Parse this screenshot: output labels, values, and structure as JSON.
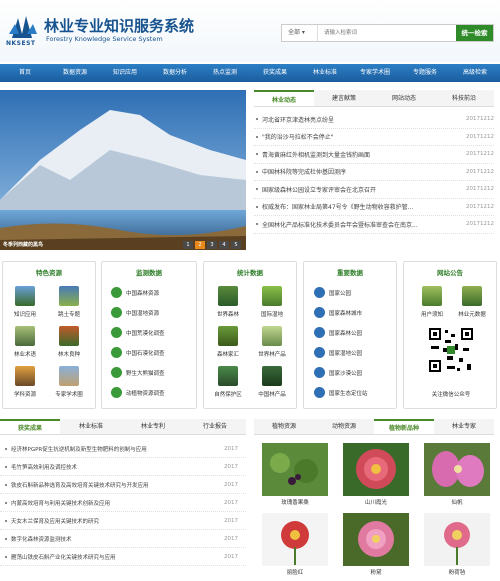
{
  "header": {
    "title_cn": "林业专业知识服务系统",
    "title_en": "Forestry Knowledge Service System",
    "logo_text": "NKSEST"
  },
  "search": {
    "scope": "全部 ▾",
    "placeholder": "请输入检索词",
    "button": "统一检索"
  },
  "nav": [
    "首页",
    "数据资源",
    "知识应用",
    "数据分析",
    "热点监测",
    "获奖成果",
    "林业标准",
    "专家学术圈",
    "专题服务",
    "高级检索"
  ],
  "banner": {
    "caption": "冬季列西藏的黑鸟",
    "pages": [
      "1",
      "2",
      "3",
      "4",
      "5"
    ],
    "active_page": "2"
  },
  "news": {
    "tabs": [
      "林业动态",
      "建言献策",
      "网站动态",
      "科技前沿"
    ],
    "active_tab": "林业动态",
    "items": [
      {
        "title": "河北省环京津造林亮点纷呈",
        "date": "20171212"
      },
      {
        "title": "\"我的治沙马拉松不会停止\"",
        "date": "20171212"
      },
      {
        "title": "青海黄麻红外相机监测到大量金钱豹画面",
        "date": "20171212"
      },
      {
        "title": "中国林科院等完成杜仲基因测序",
        "date": "20171212"
      },
      {
        "title": "国家级森林公园设立专家评审会在北京召开",
        "date": "20171212"
      },
      {
        "title": "权威发布：国家林业局第47号令《野生动物收容救护管...",
        "date": "20171212"
      },
      {
        "title": "全国林化产品标准化技术委员会年会暨标准审查会在南京...",
        "date": "20171212"
      }
    ]
  },
  "features": {
    "title": "特色资源",
    "items": [
      "知识应用",
      "跳土专题",
      "林业术语",
      "林木良种",
      "学科资源",
      "专家学术圈"
    ]
  },
  "monitor": {
    "title": "监测数据",
    "items": [
      "中国森林资源",
      "中国湿地资源",
      "中国荒漠化调查",
      "中国石漠化调查",
      "野生大熊猫调查",
      "动植物资源调查"
    ]
  },
  "stats": {
    "title": "统计数据",
    "items": [
      "世界森林",
      "国际湿地",
      "森林家汇",
      "世界林产品",
      "自然保护区",
      "中国林产品"
    ]
  },
  "important": {
    "title": "重要数据",
    "items": [
      "国家公园",
      "国家森林城市",
      "国家森林公园",
      "国家湿地公园",
      "国家沙漠公园",
      "国家生态定位站"
    ]
  },
  "notice": {
    "title": "网站公告",
    "items": [
      "用户须知",
      "林业元数据"
    ],
    "qr_caption": "关注微信公众号"
  },
  "awards": {
    "tabs": [
      "获奖成果",
      "林业标准",
      "林业专利",
      "行业报告"
    ],
    "active_tab": "获奖成果",
    "items": [
      {
        "title": "经济林PGPR促生抗逆机制及新型生物肥料的创制与应用",
        "date": "2017"
      },
      {
        "title": "毛竹笋高效利用及调控技术",
        "date": "2017"
      },
      {
        "title": "铁皮石斛新品种选育及高效培育关键技术研究与开发应用",
        "date": "2017"
      },
      {
        "title": "内蒙高效培育与利用关键技术创新及应用",
        "date": "2017"
      },
      {
        "title": "天女木兰保育及应用关键技术的研究",
        "date": "2017"
      },
      {
        "title": "数字化森林资源监测技术",
        "date": "2017"
      },
      {
        "title": "雁荡山铁皮石斛产业化关键技术研究与应用",
        "date": "2017"
      }
    ]
  },
  "plants": {
    "tabs": [
      "植物资源",
      "动物资源",
      "植物新品种",
      "林业专家"
    ],
    "active_tab": "植物新品种",
    "items": [
      "玫瑰香果桑",
      "山川霞光",
      "仙帆",
      "丽脸红",
      "粉黛",
      "粉荷毡"
    ]
  },
  "colors": {
    "brand_blue": "#17538e",
    "nav_blue": "#1f6bb0",
    "accent_green": "#2f8b2a",
    "active_page": "#e8891e"
  }
}
